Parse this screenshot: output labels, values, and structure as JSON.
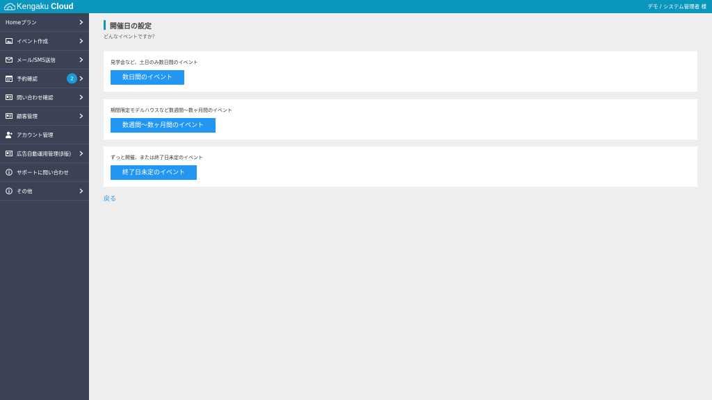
{
  "header": {
    "logo_light": "Kengaku",
    "logo_bold": "Cloud",
    "user": "デモ / システム管理者 様"
  },
  "sidebar": {
    "items": [
      {
        "label": "Homeプラン",
        "icon": "none",
        "chevron": true
      },
      {
        "label": "イベント作成",
        "icon": "image-icon",
        "chevron": true
      },
      {
        "label": "メール/SMS送信",
        "icon": "mail-icon",
        "chevron": true
      },
      {
        "label": "予約確認",
        "icon": "calendar-icon",
        "chevron": true,
        "badge": "2"
      },
      {
        "label": "問い合わせ確認",
        "icon": "id-card-icon",
        "chevron": true
      },
      {
        "label": "顧客管理",
        "icon": "id-card-icon",
        "chevron": true
      },
      {
        "label": "アカウント管理",
        "icon": "user-add-icon",
        "chevron": false
      },
      {
        "label": "広告自動運用管理(β版)",
        "icon": "id-card-icon",
        "chevron": true
      },
      {
        "label": "サポートに問い合わせ",
        "icon": "info-icon",
        "chevron": false
      },
      {
        "label": "その他",
        "icon": "info-icon",
        "chevron": true
      }
    ]
  },
  "main": {
    "title": "開催日の設定",
    "subtitle": "どんなイベントですか？",
    "cards": [
      {
        "desc": "見学会など、土日のみ数日間のイベント",
        "button": "数日間のイベント"
      },
      {
        "desc": "期間限定モデルハウスなど数週間〜数ヶ月間のイベント",
        "button": "数週間〜数ヶ月間のイベント"
      },
      {
        "desc": "ずっと開催、または終了日未定のイベント",
        "button": "終了日未定のイベント"
      }
    ],
    "back": "戻る"
  },
  "colors": {
    "header": "#0b97bd",
    "sidebar": "#3b4256",
    "button": "#2196f3",
    "badge": "#1a9ad6"
  }
}
